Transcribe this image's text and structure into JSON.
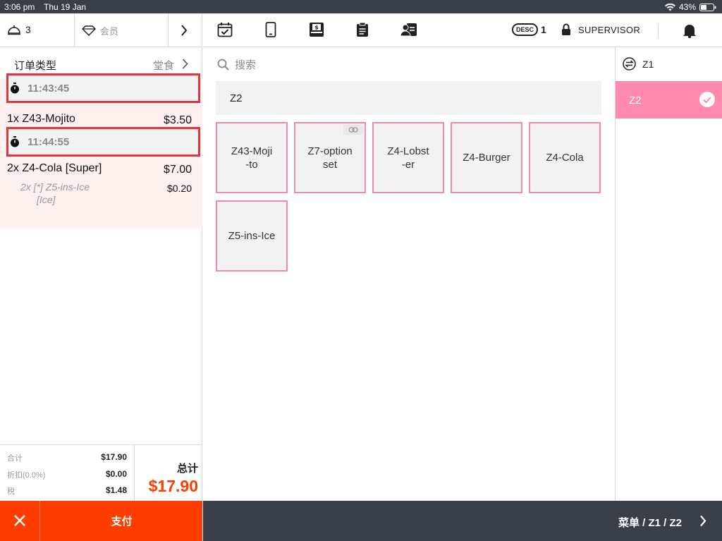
{
  "status_bar": {
    "time": "3:06 pm",
    "date": "Thu 19 Jan",
    "battery": "43%"
  },
  "left_header": {
    "guest_count": "3",
    "member_label": "会员"
  },
  "order_type": {
    "label": "订单类型",
    "value": "堂食"
  },
  "ticket": {
    "timer1": "11:43:45",
    "item1": {
      "qty_name": "1x Z43-Mojito",
      "price": "$3.50"
    },
    "timer2": "11:44:55",
    "item2": {
      "qty_name": "2x Z4-Cola  [Super]",
      "price": "$7.00"
    },
    "modifier": {
      "name": "2x [*] Z5-ins-Ice",
      "note": "[Ice]",
      "price": "$0.20"
    }
  },
  "totals": {
    "subtotal_label": "合计",
    "subtotal": "$17.90",
    "discount_label": "折扣(0.0%)",
    "discount": "$0.00",
    "tax_label": "税",
    "tax": "$1.48",
    "total_label": "总计",
    "total": "$17.90"
  },
  "actions": {
    "pay_label": "支付"
  },
  "toolbar": {
    "desc_badge": "DESC",
    "desc_count": "1",
    "user_label": "SUPERVISOR"
  },
  "search": {
    "placeholder": "搜索"
  },
  "category_header": "Z2",
  "products": [
    {
      "name": "Z43-Moji\n-to"
    },
    {
      "name": "Z7-option\nset"
    },
    {
      "name": "Z4-Lobst\n-er"
    },
    {
      "name": "Z4-Burger"
    },
    {
      "name": "Z4-Cola"
    },
    {
      "name": "Z5-ins-Ice"
    }
  ],
  "categories": [
    {
      "label": "Z1"
    },
    {
      "label": "Z2"
    }
  ],
  "breadcrumb": "菜单 / Z1 / Z2",
  "colors": {
    "accent": "#ff3d00",
    "tile_border": "#f58aaa",
    "selected_category": "#ff8aae",
    "dark_bar": "#3a3f47",
    "highlight": "#e8323c"
  }
}
